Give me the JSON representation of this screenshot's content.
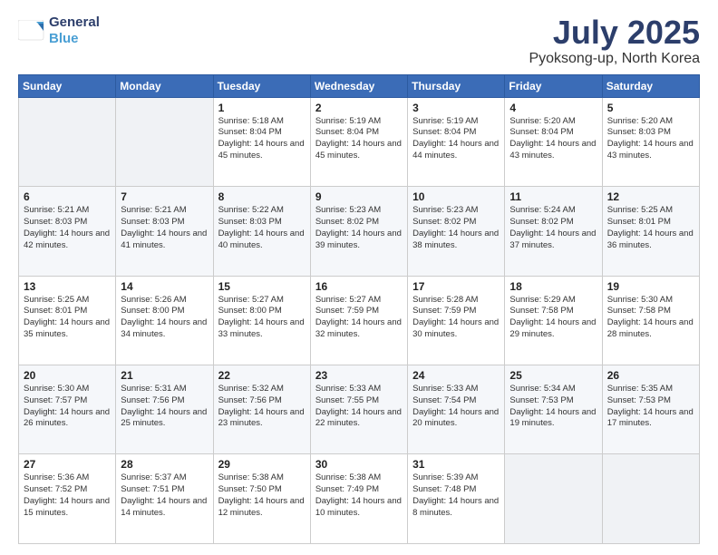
{
  "logo": {
    "line1": "General",
    "line2": "Blue"
  },
  "title": "July 2025",
  "subtitle": "Pyoksong-up, North Korea",
  "days_header": [
    "Sunday",
    "Monday",
    "Tuesday",
    "Wednesday",
    "Thursday",
    "Friday",
    "Saturday"
  ],
  "weeks": [
    [
      {
        "day": "",
        "info": ""
      },
      {
        "day": "",
        "info": ""
      },
      {
        "day": "1",
        "info": "Sunrise: 5:18 AM\nSunset: 8:04 PM\nDaylight: 14 hours and 45 minutes."
      },
      {
        "day": "2",
        "info": "Sunrise: 5:19 AM\nSunset: 8:04 PM\nDaylight: 14 hours and 45 minutes."
      },
      {
        "day": "3",
        "info": "Sunrise: 5:19 AM\nSunset: 8:04 PM\nDaylight: 14 hours and 44 minutes."
      },
      {
        "day": "4",
        "info": "Sunrise: 5:20 AM\nSunset: 8:04 PM\nDaylight: 14 hours and 43 minutes."
      },
      {
        "day": "5",
        "info": "Sunrise: 5:20 AM\nSunset: 8:03 PM\nDaylight: 14 hours and 43 minutes."
      }
    ],
    [
      {
        "day": "6",
        "info": "Sunrise: 5:21 AM\nSunset: 8:03 PM\nDaylight: 14 hours and 42 minutes."
      },
      {
        "day": "7",
        "info": "Sunrise: 5:21 AM\nSunset: 8:03 PM\nDaylight: 14 hours and 41 minutes."
      },
      {
        "day": "8",
        "info": "Sunrise: 5:22 AM\nSunset: 8:03 PM\nDaylight: 14 hours and 40 minutes."
      },
      {
        "day": "9",
        "info": "Sunrise: 5:23 AM\nSunset: 8:02 PM\nDaylight: 14 hours and 39 minutes."
      },
      {
        "day": "10",
        "info": "Sunrise: 5:23 AM\nSunset: 8:02 PM\nDaylight: 14 hours and 38 minutes."
      },
      {
        "day": "11",
        "info": "Sunrise: 5:24 AM\nSunset: 8:02 PM\nDaylight: 14 hours and 37 minutes."
      },
      {
        "day": "12",
        "info": "Sunrise: 5:25 AM\nSunset: 8:01 PM\nDaylight: 14 hours and 36 minutes."
      }
    ],
    [
      {
        "day": "13",
        "info": "Sunrise: 5:25 AM\nSunset: 8:01 PM\nDaylight: 14 hours and 35 minutes."
      },
      {
        "day": "14",
        "info": "Sunrise: 5:26 AM\nSunset: 8:00 PM\nDaylight: 14 hours and 34 minutes."
      },
      {
        "day": "15",
        "info": "Sunrise: 5:27 AM\nSunset: 8:00 PM\nDaylight: 14 hours and 33 minutes."
      },
      {
        "day": "16",
        "info": "Sunrise: 5:27 AM\nSunset: 7:59 PM\nDaylight: 14 hours and 32 minutes."
      },
      {
        "day": "17",
        "info": "Sunrise: 5:28 AM\nSunset: 7:59 PM\nDaylight: 14 hours and 30 minutes."
      },
      {
        "day": "18",
        "info": "Sunrise: 5:29 AM\nSunset: 7:58 PM\nDaylight: 14 hours and 29 minutes."
      },
      {
        "day": "19",
        "info": "Sunrise: 5:30 AM\nSunset: 7:58 PM\nDaylight: 14 hours and 28 minutes."
      }
    ],
    [
      {
        "day": "20",
        "info": "Sunrise: 5:30 AM\nSunset: 7:57 PM\nDaylight: 14 hours and 26 minutes."
      },
      {
        "day": "21",
        "info": "Sunrise: 5:31 AM\nSunset: 7:56 PM\nDaylight: 14 hours and 25 minutes."
      },
      {
        "day": "22",
        "info": "Sunrise: 5:32 AM\nSunset: 7:56 PM\nDaylight: 14 hours and 23 minutes."
      },
      {
        "day": "23",
        "info": "Sunrise: 5:33 AM\nSunset: 7:55 PM\nDaylight: 14 hours and 22 minutes."
      },
      {
        "day": "24",
        "info": "Sunrise: 5:33 AM\nSunset: 7:54 PM\nDaylight: 14 hours and 20 minutes."
      },
      {
        "day": "25",
        "info": "Sunrise: 5:34 AM\nSunset: 7:53 PM\nDaylight: 14 hours and 19 minutes."
      },
      {
        "day": "26",
        "info": "Sunrise: 5:35 AM\nSunset: 7:53 PM\nDaylight: 14 hours and 17 minutes."
      }
    ],
    [
      {
        "day": "27",
        "info": "Sunrise: 5:36 AM\nSunset: 7:52 PM\nDaylight: 14 hours and 15 minutes."
      },
      {
        "day": "28",
        "info": "Sunrise: 5:37 AM\nSunset: 7:51 PM\nDaylight: 14 hours and 14 minutes."
      },
      {
        "day": "29",
        "info": "Sunrise: 5:38 AM\nSunset: 7:50 PM\nDaylight: 14 hours and 12 minutes."
      },
      {
        "day": "30",
        "info": "Sunrise: 5:38 AM\nSunset: 7:49 PM\nDaylight: 14 hours and 10 minutes."
      },
      {
        "day": "31",
        "info": "Sunrise: 5:39 AM\nSunset: 7:48 PM\nDaylight: 14 hours and 8 minutes."
      },
      {
        "day": "",
        "info": ""
      },
      {
        "day": "",
        "info": ""
      }
    ]
  ]
}
